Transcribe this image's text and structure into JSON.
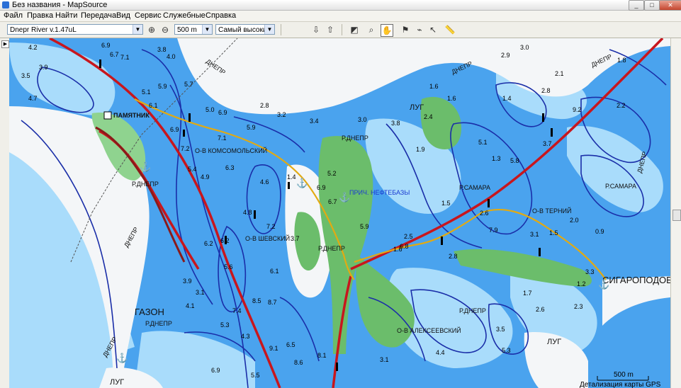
{
  "window": {
    "title": "Без названия - MapSource",
    "controls": [
      "_",
      "□",
      "✕"
    ]
  },
  "menu": [
    "Файл",
    "Правка",
    "Найти",
    "Передача",
    "Вид",
    "Сервис",
    "Служебные",
    "Справка"
  ],
  "toolbar": {
    "map_product": "Dnepr River v.1.47uL",
    "zoom_level": "500 m",
    "detail_level": "Самый высокий",
    "zoom_in_icon": "zoom-in-icon",
    "zoom_out_icon": "zoom-out-icon"
  },
  "map": {
    "place_labels": [
      "ПАМЯТНИК",
      "О-В КОМСОМОЛЬСКИЙ",
      "Р.ДНЕПР",
      "Р.ДНЕПР",
      "ПРИЧ. НЕФТЕБАЗЫ",
      "ЛУГ",
      "ДНЕПР",
      "ДНЕПР",
      "ДНЕПР",
      "Р.САМАРА",
      "Р.САМАРА",
      "О-В ТЕРНИЙ",
      "О-В ШЕВСКИЙ",
      "Р.ДНЕПР",
      "ГАЗОН",
      "Р.ДНЕПР",
      "Р.ДНЕПР",
      "О-В АЛЕКСЕЕВСКИЙ",
      "СИГАРОПОДОБ",
      "ЛУГ",
      "ДНЕПР",
      "ДНЕПР",
      "ЛУГ",
      "ДНЕПР"
    ],
    "depth_soundings": [
      "4.2",
      "3.9",
      "3.5",
      "4.7",
      "6.9",
      "6.7",
      "7.1",
      "3.8",
      "4.0",
      "5.1",
      "5.7",
      "5.9",
      "6.1",
      "5.0",
      "6.9",
      "2.8",
      "3.2",
      "5.9",
      "6.9",
      "7.1",
      "7.2",
      "5.4",
      "4.9",
      "6.3",
      "4.6",
      "1.4",
      "6.9",
      "5.2",
      "6.7",
      "3.0",
      "3.4",
      "3.8",
      "2.4",
      "1.6",
      "1.9",
      "2.9",
      "3.0",
      "2.1",
      "1.6",
      "1.4",
      "2.2",
      "2.8",
      "9.2",
      "1.8",
      "5.1",
      "3.7",
      "5.8",
      "2.5",
      "1.6",
      "5.9",
      "6.2",
      "4.8",
      "7.2",
      "1.5",
      "1.3",
      "2.6",
      "7.9",
      "3.1",
      "1.5",
      "6.8",
      "2.0",
      "0.9",
      "3.3",
      "1.2",
      "4.1",
      "3.9",
      "3.1",
      "6.2",
      "5.6",
      "7.4",
      "8.5",
      "8.7",
      "6.1",
      "5.3",
      "4.3",
      "9.1",
      "6.5",
      "8.6",
      "5.5",
      "6.9",
      "3.7",
      "8.1",
      "2.8",
      "1.7",
      "2.3",
      "4.4",
      "5.3",
      "3.5",
      "3.1",
      "2.6"
    ],
    "scale_label": "500 m",
    "detail_note": "Детализация карты GPS"
  },
  "colors": {
    "deep_water": "#4aa3ee",
    "shallow_water": "#a9dcfb",
    "land": "#f4f6f8",
    "vegetation": "#6bbd6b",
    "contour": "#1a2ea8",
    "road": "#c8161d",
    "route_gold": "#e2aa12"
  }
}
